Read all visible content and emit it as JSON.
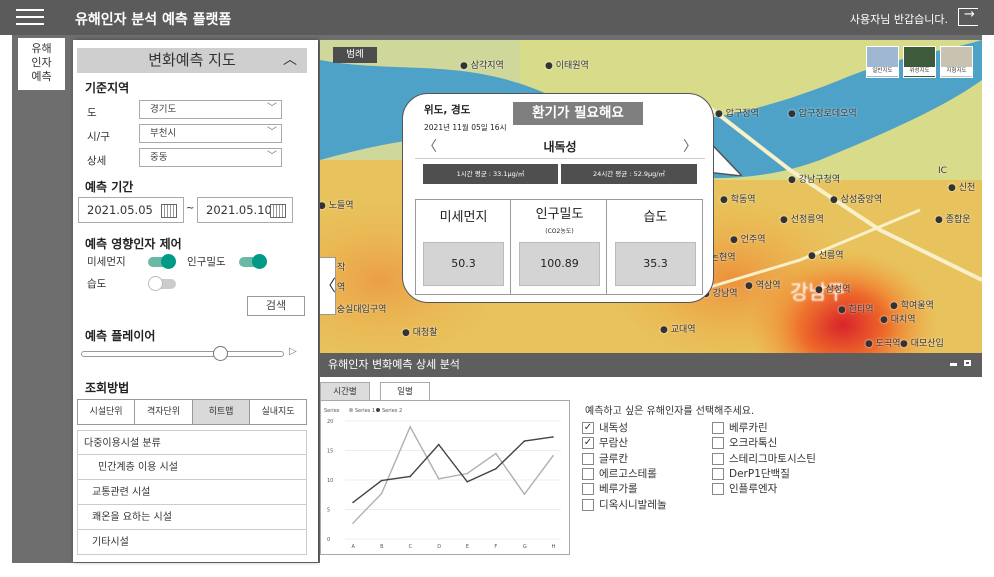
{
  "header": {
    "title": "유해인자 분석 예측 플랫폼",
    "greeting": "사용자님 반갑습니다.",
    "icons": [
      "menu-icon",
      "logout-icon"
    ]
  },
  "nav": {
    "tab_label_lines": [
      "유해",
      "인자",
      "예측"
    ]
  },
  "panel": {
    "title": "변화예측 지도",
    "region": {
      "heading": "기준지역",
      "rows": [
        {
          "label": "도",
          "value": "경기도"
        },
        {
          "label": "시/구",
          "value": "부천시"
        },
        {
          "label": "상세",
          "value": "중동"
        }
      ]
    },
    "period": {
      "heading": "예측 기간",
      "start": "2021.05.05",
      "separator": "~",
      "end": "2021.05.10"
    },
    "factors": {
      "heading": "예측 영향인자 제어",
      "items": [
        {
          "label": "미세먼지",
          "on": true
        },
        {
          "label": "인구밀도",
          "on": true
        },
        {
          "label": "습도",
          "on": false
        }
      ]
    },
    "search_label": "검색",
    "player": {
      "heading": "예측 플레이어",
      "position": 0.3
    },
    "query": {
      "heading": "조회방법",
      "tabs": [
        "시설단위",
        "격자단위",
        "히트맵",
        "실내지도"
      ],
      "active_tab": 2,
      "list": [
        "다중이용시설 분류",
        "민간계층 이용 시설",
        "교통관련 시설",
        "쾌온을 요하는 시설",
        "기타시설"
      ]
    }
  },
  "map": {
    "legend_label": "범례",
    "map_types": [
      "일반지도",
      "위성지도",
      "지형지도"
    ],
    "labels": [
      "삼각지역",
      "이태원역",
      "압구정역",
      "압구정로데오역",
      "강남구청역",
      "학동역",
      "삼성중앙역",
      "선정릉역",
      "종합운",
      "신천",
      "논현역",
      "언주역",
      "선릉역",
      "강남역",
      "역삼역",
      "한티역",
      "대치역",
      "학여울역",
      "교대역",
      "도곡역",
      "대모산입",
      "대청찰",
      "노들역",
      "숭실대입구역",
      "강남구",
      "삼성역",
      "IC",
      "동작",
      "소역"
    ],
    "popup": {
      "latlng_title": "위도, 경도",
      "datetime": "2021년 11월 05일 16시",
      "alert": "환기가 필요해요",
      "location": "내독성",
      "avg_1h": "1시간 평균 : 33.1μg/㎥",
      "avg_24h": "24시간 평균 : 52.9μg/㎥",
      "metrics": [
        {
          "name": "미세먼지",
          "sub": "",
          "value": "50.3"
        },
        {
          "name": "인구밀도",
          "sub": "(CO2농도)",
          "value": "100.89"
        },
        {
          "name": "습도",
          "sub": "",
          "value": "35.3"
        }
      ]
    }
  },
  "analysis": {
    "title": "유해인자 변화예측 상세 분석",
    "tabs": [
      "시간별",
      "일별"
    ],
    "active_tab": 1,
    "prompt": "예측하고 싶은 유해인자를 선택해주세요.",
    "options_col1": [
      {
        "label": "내독성",
        "checked": true
      },
      {
        "label": "무람산",
        "checked": true
      },
      {
        "label": "글루칸",
        "checked": false
      },
      {
        "label": "에르고스테롤",
        "checked": false
      },
      {
        "label": "베루가롤",
        "checked": false
      },
      {
        "label": "디옥시니발레놀",
        "checked": false
      }
    ],
    "options_col2": [
      {
        "label": "베루카린",
        "checked": false
      },
      {
        "label": "오크라톡신",
        "checked": false
      },
      {
        "label": "스테리그마토시스틴",
        "checked": false
      },
      {
        "label": "DerP1단백질",
        "checked": false
      },
      {
        "label": "인플루엔자",
        "checked": false
      }
    ]
  },
  "chart_data": {
    "type": "line",
    "title": "Series",
    "categories": [
      "A",
      "B",
      "C",
      "D",
      "E",
      "F",
      "G",
      "H"
    ],
    "series": [
      {
        "name": "Series 1",
        "color": "#b0b0b0",
        "values": [
          2.7,
          7.7,
          19.0,
          10.2,
          11.1,
          14.5,
          7.6,
          14.1
        ]
      },
      {
        "name": "Series 2",
        "color": "#444444",
        "values": [
          6.2,
          9.9,
          10.6,
          16.0,
          9.7,
          11.9,
          16.6,
          17.3
        ]
      }
    ],
    "ylim": [
      0,
      20
    ],
    "yticks": [
      0,
      5,
      10,
      15,
      20
    ],
    "grid": true,
    "legend": "top-left"
  }
}
